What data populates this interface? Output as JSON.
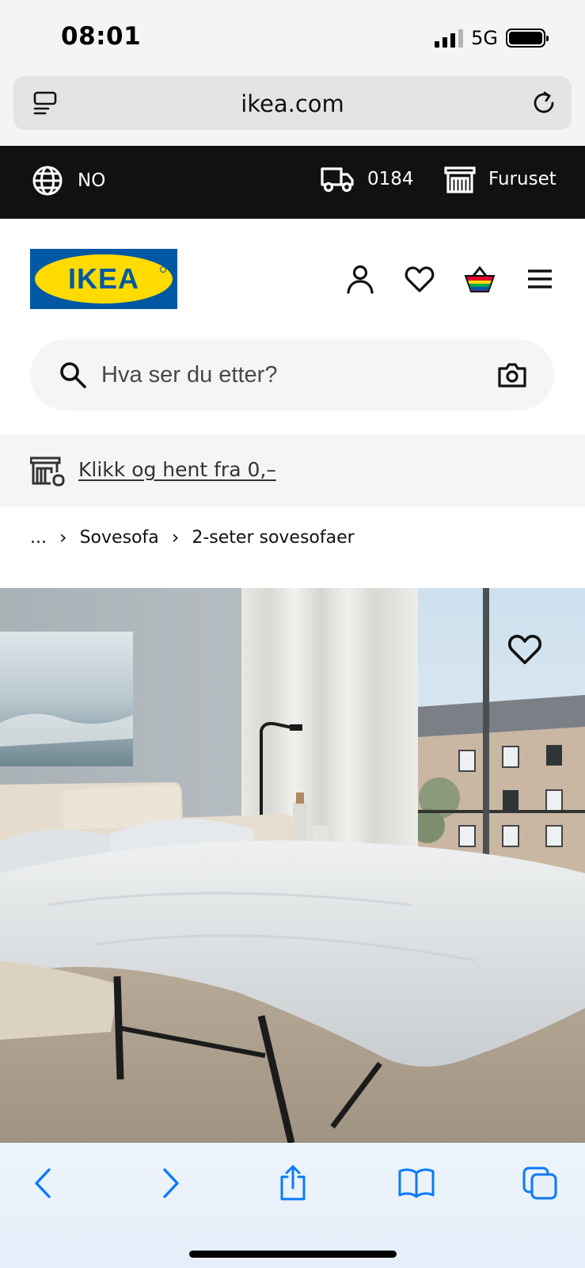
{
  "status_bar": {
    "time": "08:01",
    "network": "5G"
  },
  "browser": {
    "url": "ikea.com"
  },
  "topbar": {
    "language": "NO",
    "postal_code": "0184",
    "store": "Furuset"
  },
  "header": {
    "logo_text": "IKEA",
    "search_placeholder": "Hva ser du etter?"
  },
  "banner": {
    "link_text": "Klikk og hent fra 0,–"
  },
  "breadcrumb": {
    "ellipsis": "...",
    "items": [
      "Sovesofa",
      "2-seter sovesofaer"
    ]
  },
  "colors": {
    "ikea_blue": "#0058a3",
    "ikea_yellow": "#ffdb00",
    "topbar_bg": "#111111",
    "toolbar_blue": "#0a7aff"
  },
  "icons": {
    "topbar": [
      "globe-icon",
      "truck-icon",
      "store-icon"
    ],
    "header": [
      "user-icon",
      "heart-icon",
      "basket-icon",
      "menu-icon"
    ],
    "toolbar": [
      "back-icon",
      "forward-icon",
      "share-icon",
      "bookmarks-icon",
      "tabs-icon"
    ]
  }
}
